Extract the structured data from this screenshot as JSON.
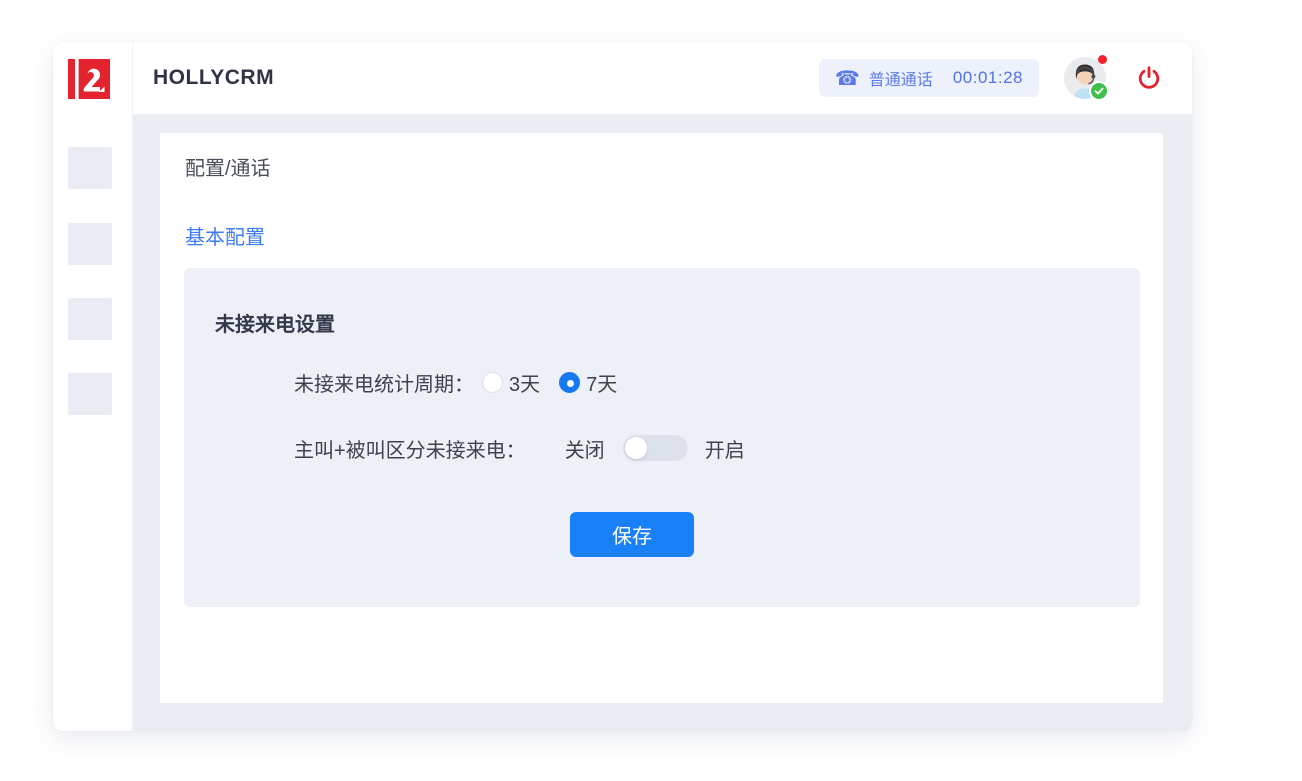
{
  "app": {
    "title": "HOLLYCRM"
  },
  "header": {
    "call_badge": {
      "phone_icon": "black-telephone",
      "label": "普通通话",
      "timer": "00:01:28"
    },
    "avatar": {
      "status": "online-available",
      "notification_dot": true
    },
    "power_icon": "power-logout"
  },
  "sidebar": {
    "placeholder_items": 4
  },
  "page": {
    "breadcrumb": "配置/通话",
    "tab": "基本配置",
    "section": {
      "title": "未接来电设置",
      "radio_row": {
        "label": "未接来电统计周期：",
        "options": [
          {
            "label": "3天",
            "selected": false
          },
          {
            "label": "7天",
            "selected": true
          }
        ]
      },
      "toggle_row": {
        "label": "主叫+被叫区分未接来电：",
        "off_label": "关闭",
        "on_label": "开启",
        "state": "off"
      },
      "save_label": "保存"
    }
  },
  "colors": {
    "accent_blue": "#1a80f8",
    "radio_selected": "#1778f2",
    "tab_blue": "#3e7cf7",
    "badge_blue": "#5b7ce8",
    "badge_bg": "#edf1fc",
    "brand_red": "#e3242f",
    "power_red": "#e0232f",
    "notification_red": "#f5222d",
    "status_green": "#3fc04b",
    "main_bg": "#eaedf2",
    "settings_box_bg": "#edf0f7",
    "dark_text": "#3d4250"
  }
}
